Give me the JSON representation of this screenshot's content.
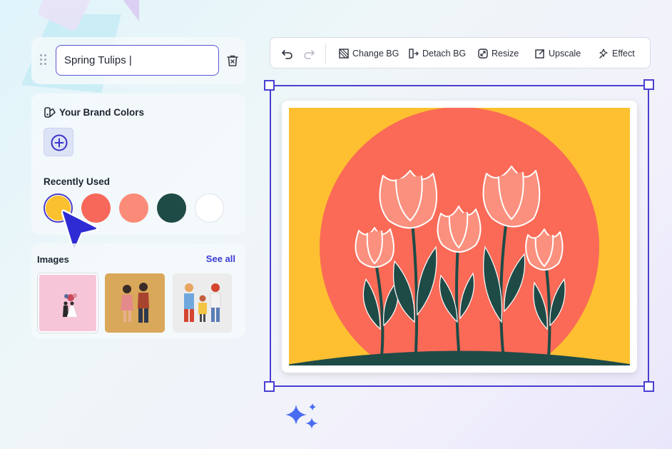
{
  "name_panel": {
    "title_value": "Spring Tulips |"
  },
  "brand_colors": {
    "title": "Your Brand Colors",
    "recent_title": "Recently Used",
    "recent_colors": [
      "#fbc02d",
      "#f7675a",
      "#fb8b79",
      "#1f4b47",
      "#ffffff"
    ],
    "selected_index": 0
  },
  "images": {
    "title": "Images",
    "see_all": "See all"
  },
  "toolbar": {
    "change_bg": "Change BG",
    "detach_bg": "Detach BG",
    "resize": "Resize",
    "upscale": "Upscale",
    "effect": "Effect"
  },
  "colors": {
    "accent": "#4a3fd1",
    "link": "#3a3ad6",
    "art_background": "#fec030",
    "art_sun": "#fa6a57",
    "art_petal": "#fb907e",
    "art_leaf": "#1f4b47"
  }
}
